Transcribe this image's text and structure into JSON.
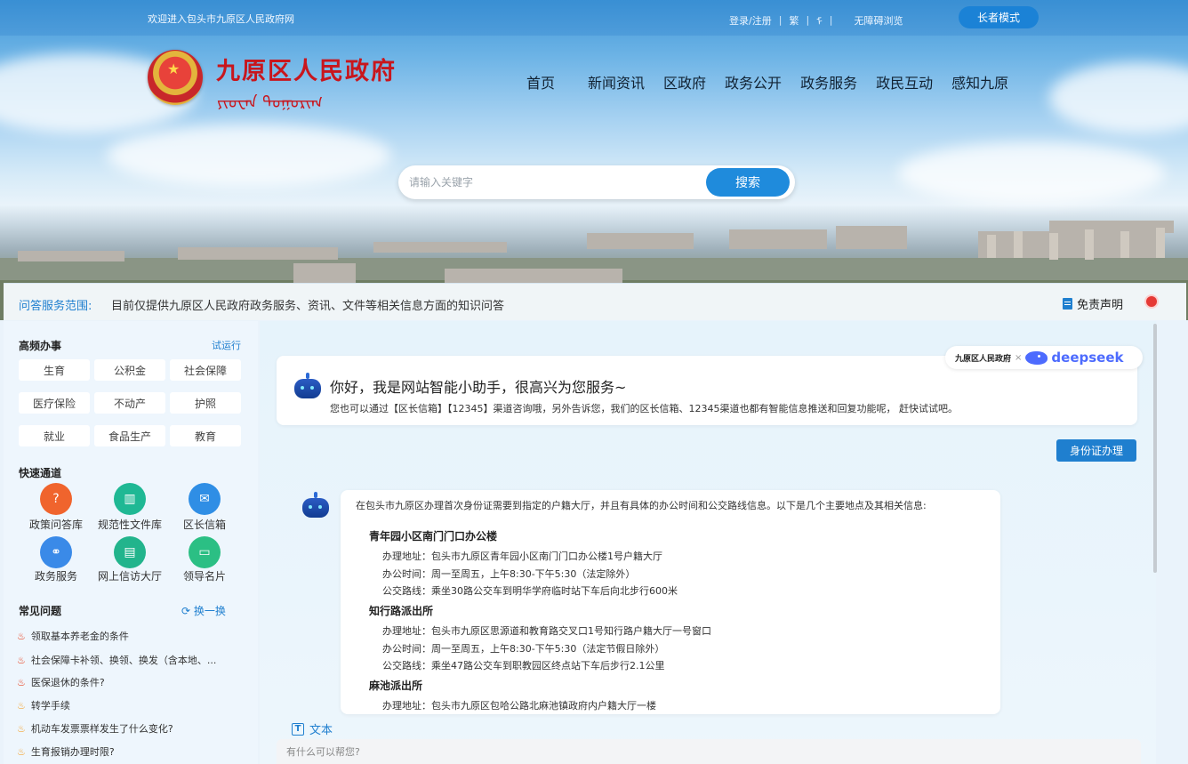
{
  "topbar": {
    "welcome": "欢迎进入包头市九原区人民政府网",
    "login": "登录/注册",
    "traditional": "繁",
    "mongolian": "ᠮ",
    "accessible": "无障碍浏览",
    "elder_mode": "长者模式"
  },
  "site": {
    "title": "九原区人民政府",
    "mongolian_title": "ᠶᠢᠦᠸᠠᠨ ᠲᠣᠭᠣᠷᠢᠭ"
  },
  "nav": [
    "首页",
    "新闻资讯",
    "区政府",
    "政务公开",
    "政务服务",
    "政民互动",
    "感知九原"
  ],
  "search": {
    "placeholder": "请输入关键字",
    "button": "搜索"
  },
  "scope": {
    "label": "问答服务范围:",
    "text": "目前仅提供九原区人民政府政务服务、资讯、文件等相关信息方面的知识问答",
    "disclaimer": "免责声明"
  },
  "sidebar": {
    "high_freq_title": "高频办事",
    "trial": "试运行",
    "chips": [
      "生育",
      "公积金",
      "社会保障",
      "医疗保险",
      "不动产",
      "护照",
      "就业",
      "食品生产",
      "教育"
    ],
    "quick_title": "快速通道",
    "quick": [
      {
        "label": "政策问答库",
        "icon": "policy-qa-icon",
        "color": "#f0642d",
        "glyph": "?"
      },
      {
        "label": "规范性文件库",
        "icon": "file-library-icon",
        "color": "#1fb894",
        "glyph": "▥"
      },
      {
        "label": "区长信箱",
        "icon": "mailbox-icon",
        "color": "#2f8ee5",
        "glyph": "✉"
      },
      {
        "label": "政务服务",
        "icon": "handshake-icon",
        "color": "#3a8ae8",
        "glyph": "⚭"
      },
      {
        "label": "网上信访大厅",
        "icon": "petition-icon",
        "color": "#22b48c",
        "glyph": "▤"
      },
      {
        "label": "领导名片",
        "icon": "leader-card-icon",
        "color": "#2bbf84",
        "glyph": "▭"
      }
    ],
    "faq_title": "常见问题",
    "refresh": "换一换",
    "faqs": [
      {
        "text": "领取基本养老金的条件",
        "level": "hot"
      },
      {
        "text": "社会保障卡补领、换领、换发（含本地、...",
        "level": "hot"
      },
      {
        "text": "医保退休的条件?",
        "level": "hot"
      },
      {
        "text": "转学手续",
        "level": "warm"
      },
      {
        "text": "机动车发票票样发生了什么变化?",
        "level": "warm"
      },
      {
        "text": "生育报销办理时限?",
        "level": "warm"
      }
    ]
  },
  "chat": {
    "brand_gov": "九原区人民政府",
    "brand_x": "×",
    "brand_ds": "deepseek",
    "greeting": "你好，我是网站智能小助手，很高兴为您服务~",
    "greeting_sub": "您也可以通过【区长信箱】【12345】渠道咨询哦，另外告诉您，我们的区长信箱、12345渠道也都有智能信息推送和回复功能呢， 赶快试试吧。",
    "user_query": "身份证办理",
    "answer_intro": "在包头市九原区办理首次身份证需要到指定的户籍大厅，并且有具体的办公时间和公交路线信息。以下是几个主要地点及其相关信息:",
    "locations": [
      {
        "name": "青年园小区南门门口办公楼",
        "lines": [
          "办理地址：包头市九原区青年园小区南门门口办公楼1号户籍大厅",
          "办公时间：周一至周五，上午8:30-下午5:30（法定除外）",
          "公交路线：乘坐30路公交车到明华学府临时站下车后向北步行600米"
        ]
      },
      {
        "name": "知行路派出所",
        "lines": [
          "办理地址：包头市九原区思源道和教育路交叉口1号知行路户籍大厅一号窗口",
          "办公时间：周一至周五，上午8:30-下午5:30（法定节假日除外）",
          "公交路线：乘坐47路公交车到职教园区终点站下车后步行2.1公里"
        ]
      },
      {
        "name": "麻池派出所",
        "lines": [
          "办理地址：包头市九原区包哈公路北麻池镇政府内户籍大厅一楼"
        ]
      }
    ],
    "text_mode": "文本",
    "input_placeholder": "有什么可以帮您?"
  }
}
